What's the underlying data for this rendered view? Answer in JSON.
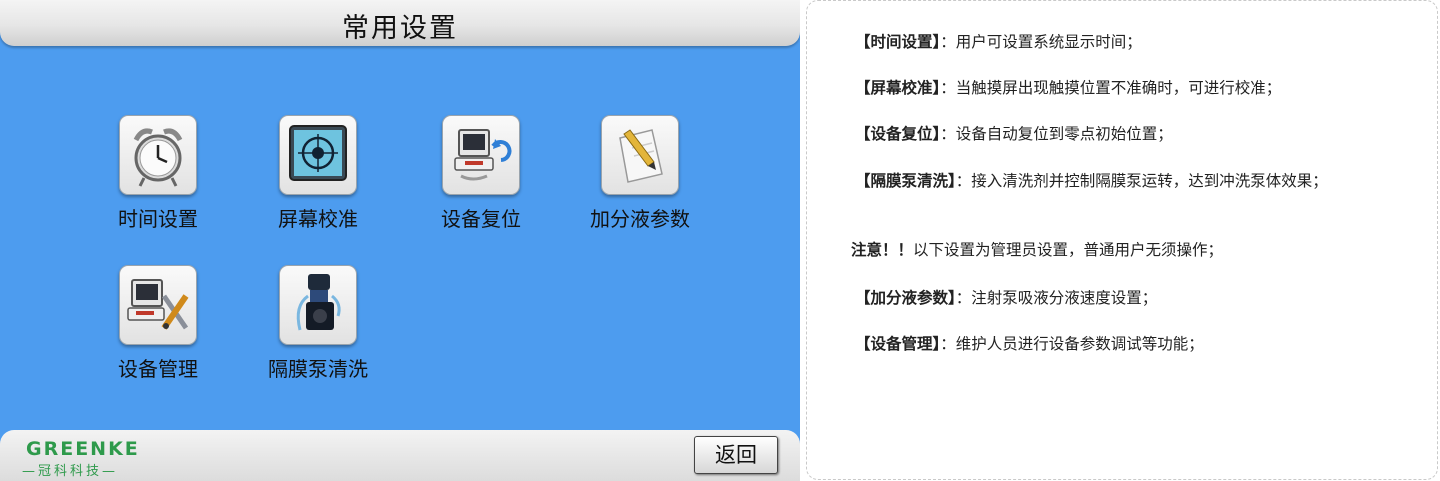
{
  "screen": {
    "title": "常用设置",
    "tiles": [
      {
        "label": "时间设置",
        "icon": "alarm-clock-icon"
      },
      {
        "label": "屏幕校准",
        "icon": "crosshair-target-icon"
      },
      {
        "label": "设备复位",
        "icon": "computer-refresh-icon"
      },
      {
        "label": "加分液参数",
        "icon": "pencil-paper-icon"
      },
      {
        "label": "设备管理",
        "icon": "computer-tools-icon"
      },
      {
        "label": "隔膜泵清洗",
        "icon": "pump-icon"
      }
    ],
    "logo_text": "GREENKE",
    "logo_cn": "—冠科科技—",
    "back_label": "返回"
  },
  "description": {
    "items": [
      {
        "key": "【时间设置】",
        "text": "：用户可设置系统显示时间；"
      },
      {
        "key": "【屏幕校准】",
        "text": "：当触摸屏出现触摸位置不准确时，可进行校准；"
      },
      {
        "key": "【设备复位】",
        "text": "：设备自动复位到零点初始位置；"
      },
      {
        "key": "【隔膜泵清洗】",
        "text": "：接入清洗剂并控制隔膜泵运转，达到冲洗泵体效果；"
      },
      {
        "key": "注意！！",
        "text": "以下设置为管理员设置，普通用户无须操作；"
      },
      {
        "key": "【加分液参数】",
        "text": "：注射泵吸液分液速度设置；"
      },
      {
        "key": "【设备管理】",
        "text": "：维护人员进行设备参数调试等功能；"
      }
    ]
  },
  "colors": {
    "panel_bg": "#4d9cef",
    "logo_green": "#2e9a4b"
  }
}
